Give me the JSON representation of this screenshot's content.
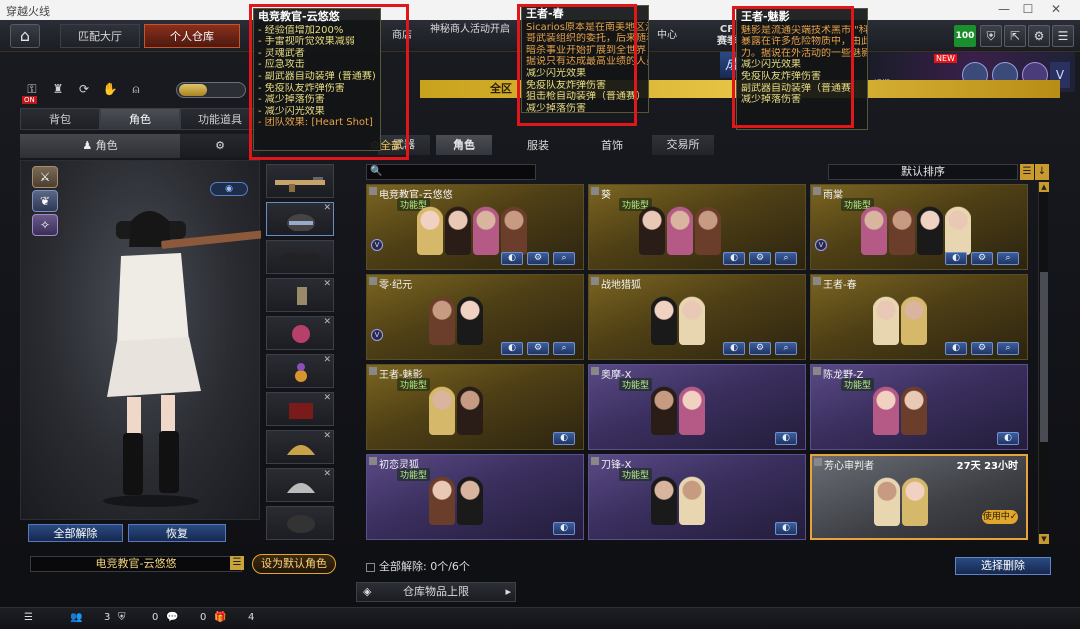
{
  "window": {
    "title": "穿越火线"
  },
  "topnav": {
    "tabs": [
      "匹配大厅",
      "个人仓库"
    ],
    "active_tab": "个人仓库",
    "extra": [
      "商店",
      "神秘商人活动开启",
      "中心"
    ],
    "cf_label": "CF",
    "cf_sub": "赛季",
    "level": "100",
    "promo_new": "NEW",
    "promo_text": "通关获得酒店擂台赛",
    "promo_tag": "近期"
  },
  "banner": {
    "text": "全区"
  },
  "left": {
    "subtabs": [
      "背包",
      "角色",
      "功能道具"
    ],
    "active_subtab": "角色",
    "role_label": "角色",
    "on_label": "ON",
    "btn_clear_all": "全部解除",
    "btn_restore": "恢复",
    "current_role": "电竞教官-云悠悠",
    "btn_set_default": "设为默认角色"
  },
  "main": {
    "tabs_top": [
      "武器",
      "角色",
      "交易所"
    ],
    "tabs": [
      "全部",
      "角色",
      "服装",
      "首饰"
    ],
    "active_tab": "全部",
    "sort_label": "默认排序",
    "clear_all_text": "全部解除: 0个/6个",
    "select_delete": "选择删除",
    "storage_limit": "仓库物品上限",
    "cards": [
      {
        "name": "电竞教官-云悠悠",
        "tag": "功能型",
        "style": "gold",
        "func": true
      },
      {
        "name": "葵",
        "tag": "功能型",
        "style": "gold",
        "func": false
      },
      {
        "name": "雨棠",
        "tag": "功能型",
        "style": "gold",
        "func": true
      },
      {
        "name": "零·纪元",
        "tag": "",
        "style": "gold",
        "func": false
      },
      {
        "name": "战地猎狐",
        "tag": "",
        "style": "gold",
        "func": false
      },
      {
        "name": "王者-春",
        "tag": "",
        "style": "gold",
        "func": false
      },
      {
        "name": "王者-魅影",
        "tag": "功能型",
        "style": "gold",
        "func": false
      },
      {
        "name": "奥摩-X",
        "tag": "功能型",
        "style": "purple",
        "func": false
      },
      {
        "name": "陈龙野-Z",
        "tag": "功能型",
        "style": "purple",
        "func": false
      },
      {
        "name": "初恋灵狐",
        "tag": "功能型",
        "style": "purple",
        "func": false
      },
      {
        "name": "刀锋-X",
        "tag": "功能型",
        "style": "purple",
        "func": false
      },
      {
        "name": "芳心审判者",
        "tag": "",
        "style": "selected",
        "func": false,
        "timer": "27天 23小时",
        "in_use": "使用中✓"
      }
    ]
  },
  "tooltips": [
    {
      "title": "电竞教官-云悠悠",
      "lines": [
        "- 经验值增加200%",
        "- 手雷视听觉效果减弱",
        "- 灵魂武者",
        "- 应急攻击",
        "- 副武器自动装弹 (普通赛)",
        "- 免疫队友炸弹伤害",
        "- 减少掉落伤害",
        "- 减少闪光效果",
        "- 团队效果: [Heart Shot]"
      ]
    },
    {
      "title": "王者-春",
      "lines": [
        "Sicarios原本是在南美地区活跃",
        "哥武装组织的委托，后来随着什",
        "暗杀事业开始扩展到全世界",
        "据说只有达成最高业绩的人员才",
        "减少闪光效果",
        "免疫队友炸弹伤害",
        "狙击枪自动装弹（普通赛）",
        "减少掉落伤害"
      ]
    },
    {
      "title": "王者-魅影",
      "lines": [
        "魅影是流通尖端技术黑市 \"科技",
        "暴露在许多危险物质中，由此得",
        "力。据说在外活动的一些魅影还",
        "减少闪光效果",
        "免疫队友炸弹伤害",
        "副武器自动装弹（普通赛）",
        "减少掉落伤害"
      ]
    }
  ],
  "statusbar": {
    "items": [
      "3",
      "0",
      "0",
      "4"
    ]
  },
  "colors": {
    "accent": "#e6a52e",
    "gold": "#c9a21d",
    "red": "#e0161a"
  }
}
